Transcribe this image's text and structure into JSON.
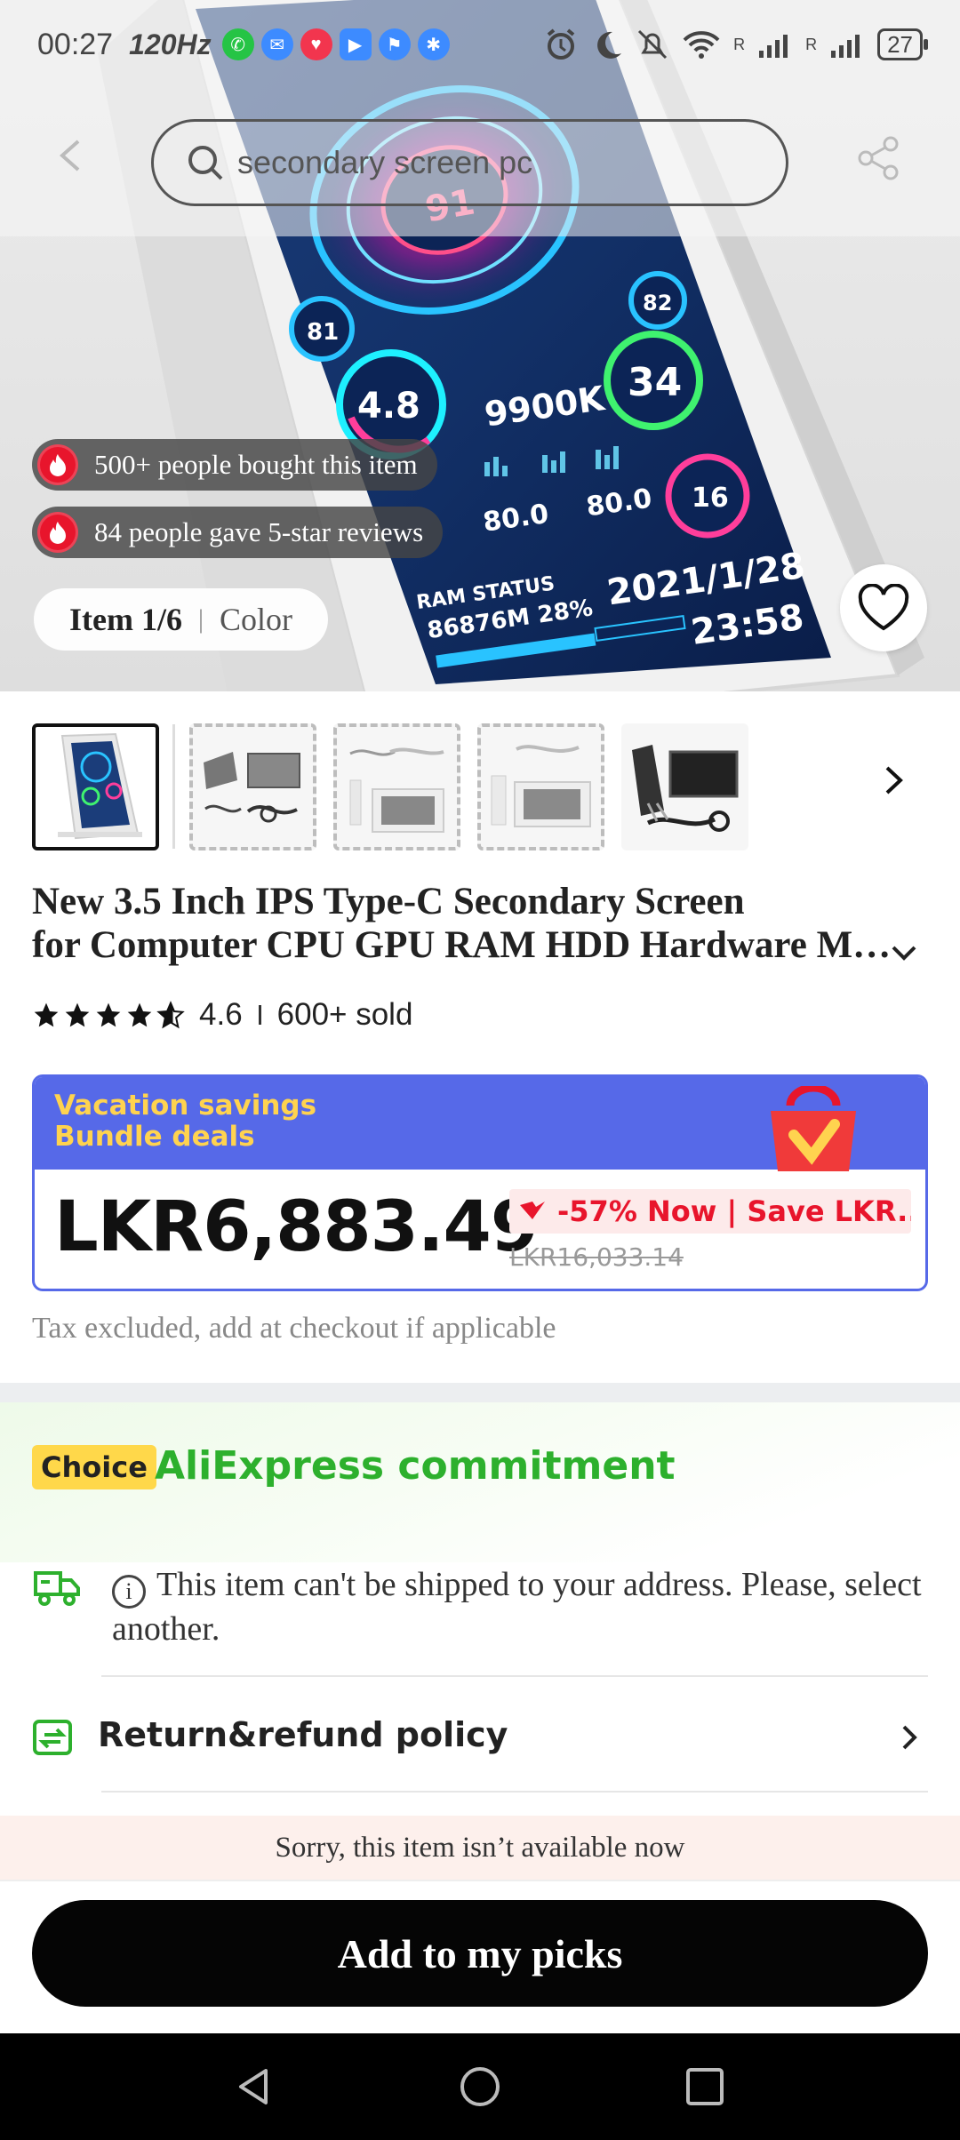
{
  "status_bar": {
    "time": "00:27",
    "refresh": "120Hz",
    "battery": "27",
    "net_label_1": "R",
    "net_label_2": "R"
  },
  "search": {
    "query": "secondary screen pc"
  },
  "hero": {
    "screen_values": {
      "big": "91",
      "gauge_a": "81",
      "gauge_b": "4.8",
      "gauge_c": "82",
      "gauge_d": "34",
      "freq": "9900K",
      "temp_a": "80.0",
      "temp_b": "80.0",
      "gauge_e": "16",
      "ram_label": "RAM STATUS",
      "ram_value": "86876M 28%",
      "date": "2021/1/28",
      "clock": "23:58"
    },
    "badges": [
      {
        "text": "500+ people bought this item"
      },
      {
        "text": "84 people gave 5-star reviews"
      }
    ],
    "item_counter": "Item 1/6",
    "item_option": "Color"
  },
  "product": {
    "title_line_1": "New 3.5 Inch IPS Type-C Secondary Screen",
    "title_line_2": "for Computer CPU GPU RAM HDD Hardware Monitor",
    "rating": "4.6",
    "sold": "600+ sold",
    "stars_filled": 4.6
  },
  "price_card": {
    "banner_line_1": "Vacation savings",
    "banner_line_2": "Bundle deals",
    "price": "LKR6,883.49",
    "discount": "-57% Now | Save LKR...",
    "original_price": "LKR16,033.14",
    "tax_note": "Tax excluded, add at checkout if applicable"
  },
  "commitment": {
    "choice_label": "Choice",
    "title": "AliExpress commitment",
    "shipping_notice": "This item can't be shipped to your address. Please, select another.",
    "return_policy": "Return&refund policy"
  },
  "footer": {
    "unavailable": "Sorry, this item isn’t available now",
    "add_button": "Add to my picks"
  },
  "colors": {
    "accent_blue": "#5669e8",
    "banner_yellow": "#ffd34f",
    "price_red": "#e8152c",
    "choice_green": "#2db02d",
    "choice_yellow": "#ffd84a"
  }
}
